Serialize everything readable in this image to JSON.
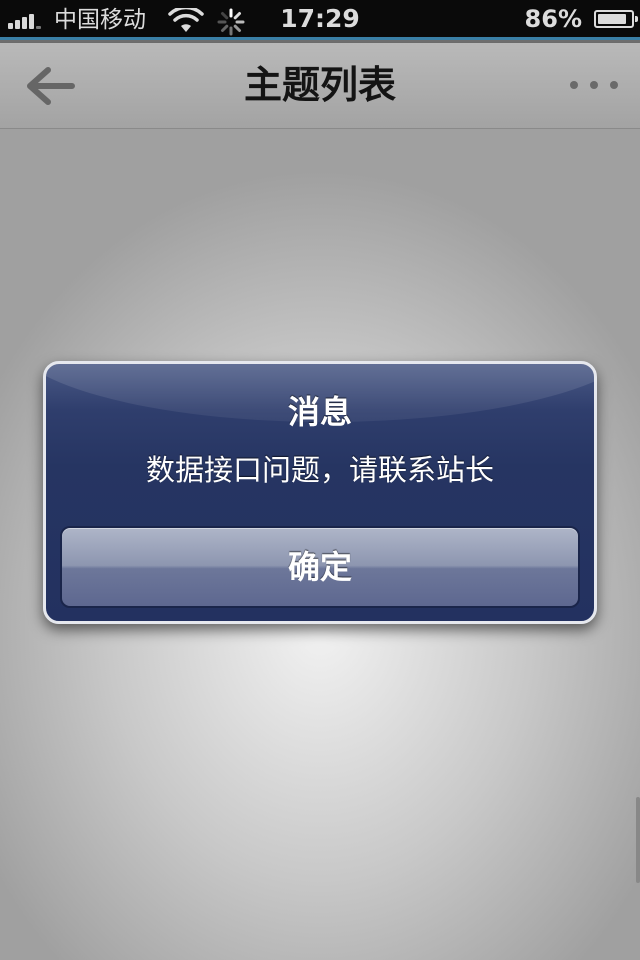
{
  "status_bar": {
    "carrier": "中国移动",
    "time": "17:29",
    "battery_percent": "86%",
    "battery_level": 0.86,
    "icons": [
      "signal-icon",
      "wifi-icon",
      "loading-spinner-icon",
      "battery-icon"
    ]
  },
  "nav_bar": {
    "title": "主题列表",
    "back_icon": "arrow-left-icon",
    "more_icon": "ellipsis-icon"
  },
  "alert": {
    "title": "消息",
    "message": "数据接口问题，请联系站长",
    "confirm_label": "确定"
  },
  "colors": {
    "status_accent": "#3a7fa6",
    "alert_background": "#263562",
    "alert_border": "#e6e8ee"
  }
}
